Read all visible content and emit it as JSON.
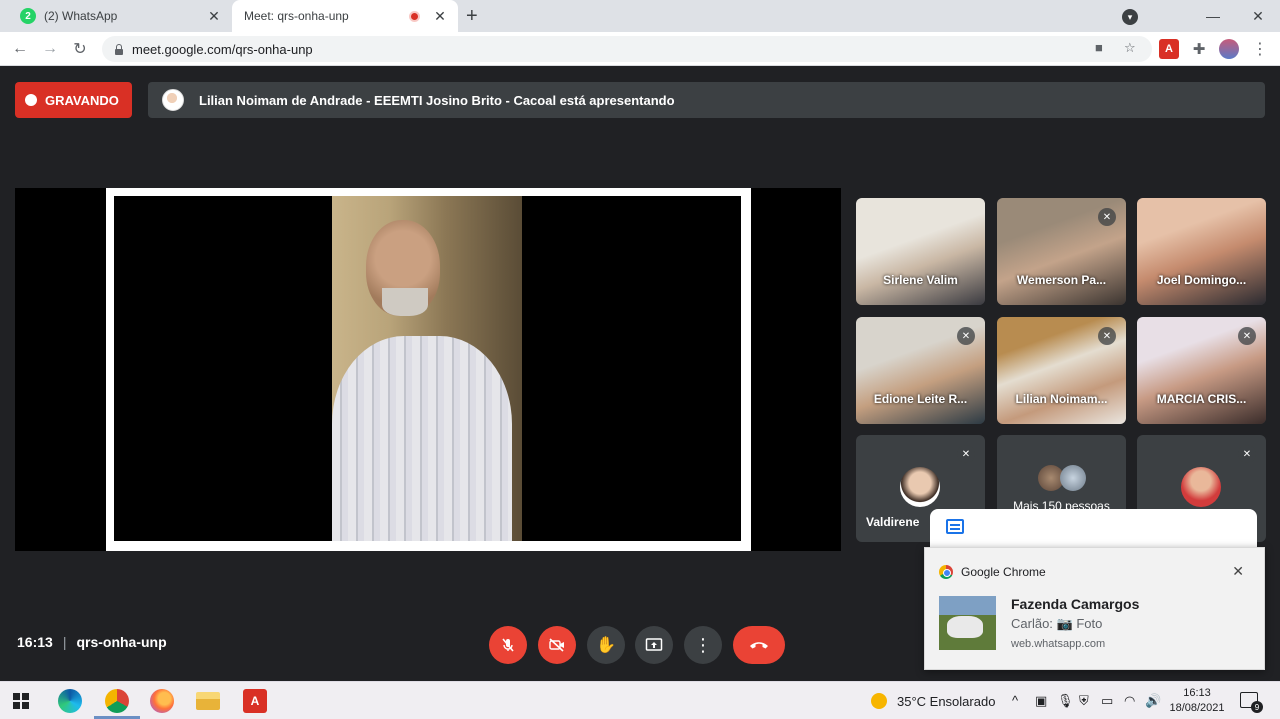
{
  "browser": {
    "tabs": [
      {
        "favicon_text": "2",
        "label": "(2) WhatsApp",
        "close": "✕"
      },
      {
        "label": "Meet: qrs-onha-unp",
        "close": "✕"
      }
    ],
    "new_tab": "+",
    "window_controls": {
      "minimize": "—",
      "maximize": "❐",
      "close": "✕"
    },
    "address": "meet.google.com/qrs-onha-unp"
  },
  "meet": {
    "recording_label": "GRAVANDO",
    "presenting_text": "Lilian Noimam de Andrade - EEEMTI Josino Brito - Cacoal está apresentando",
    "participants": [
      {
        "name": "Sirlene Valim",
        "muted": false
      },
      {
        "name": "Wemerson Pa...",
        "muted": true
      },
      {
        "name": "Joel Domingo...",
        "muted": false
      },
      {
        "name": "Edione Leite R...",
        "muted": true
      },
      {
        "name": "Lilian Noimam...",
        "muted": true
      },
      {
        "name": "MARCIA CRIS...",
        "muted": true
      },
      {
        "name": "Valdirene",
        "muted": true
      },
      {
        "name": "Mais 150 pessoas",
        "muted": false
      },
      {
        "name": "",
        "muted": true
      }
    ],
    "time": "16:13",
    "separator": "|",
    "meeting_code": "qrs-onha-unp",
    "colors": {
      "accent_red": "#ea4335",
      "recording_red": "#d93025",
      "surface": "#3c4043",
      "background": "#202124"
    }
  },
  "notification": {
    "app": "Google Chrome",
    "close": "✕",
    "title": "Fazenda Camargos",
    "message": "Carlão: 📷 Foto",
    "source": "web.whatsapp.com"
  },
  "taskbar": {
    "acrobat_label": "A",
    "weather": "35°C  Ensolarado",
    "tray_chevron": "^",
    "time": "16:13",
    "date": "18/08/2021",
    "notification_count": "9"
  }
}
